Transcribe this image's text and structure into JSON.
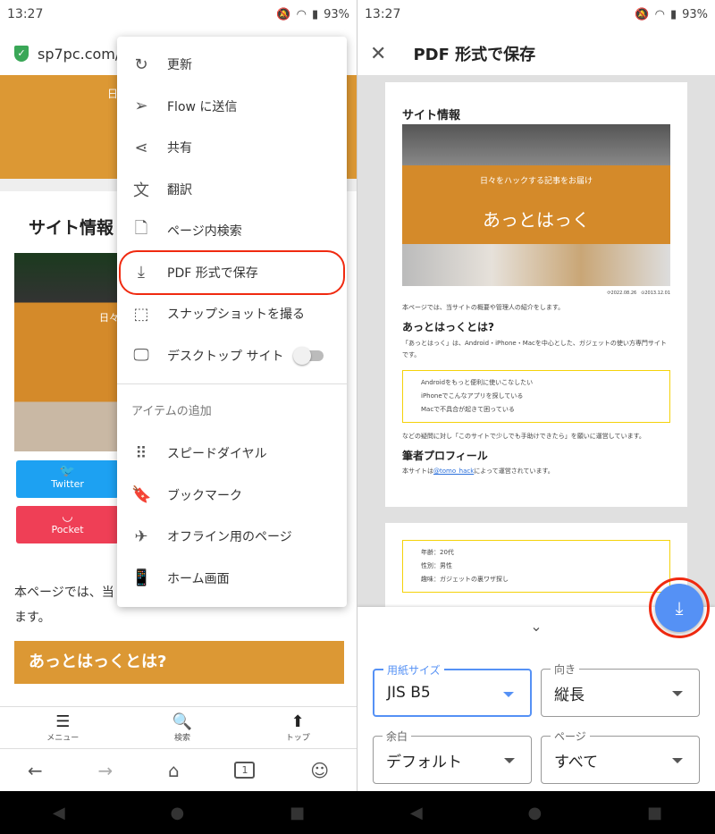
{
  "left": {
    "status": {
      "time": "13:27",
      "battery": "93%"
    },
    "url": "sp7pc.com/",
    "page": {
      "heading": "サイト情報",
      "tagline": "日々",
      "share": [
        {
          "label": "Twitter",
          "color": "#1da1f2"
        },
        {
          "label": "Pocket",
          "color": "#ef3f56"
        }
      ],
      "intro": "本ページでは、当",
      "intro2": "ます。",
      "section": "あっとはっくとは?"
    },
    "menu": {
      "items": [
        {
          "icon": "refresh-icon",
          "label": "更新"
        },
        {
          "icon": "send-icon",
          "label": "Flow に送信"
        },
        {
          "icon": "share-icon",
          "label": "共有"
        },
        {
          "icon": "translate-icon",
          "label": "翻訳"
        },
        {
          "icon": "find-in-page-icon",
          "label": "ページ内検索"
        },
        {
          "icon": "download-icon",
          "label": "PDF 形式で保存"
        },
        {
          "icon": "snapshot-icon",
          "label": "スナップショットを撮る"
        },
        {
          "icon": "desktop-icon",
          "label": "デスクトップ サイト",
          "toggle": false
        }
      ],
      "section": "アイテムの追加",
      "add_items": [
        {
          "icon": "speed-dial-icon",
          "label": "スピードダイヤル"
        },
        {
          "icon": "bookmark-icon",
          "label": "ブックマーク"
        },
        {
          "icon": "airplane-icon",
          "label": "オフライン用のページ"
        },
        {
          "icon": "home-screen-icon",
          "label": "ホーム画面"
        }
      ]
    },
    "bottom_nav": [
      {
        "icon": "menu-icon",
        "label": "メニュー"
      },
      {
        "icon": "search-icon",
        "label": "検索"
      },
      {
        "icon": "arrow-up-icon",
        "label": "トップ"
      }
    ],
    "tab_count": "1"
  },
  "right": {
    "status": {
      "time": "13:27",
      "battery": "93%"
    },
    "title": "PDF 形式で保存",
    "preview": {
      "heading": "サイト情報",
      "tagline": "日々をハックする記事をお届け",
      "site": "あっとはっく",
      "dates": "⟳2022.08.26　⊙2013.12.01",
      "intro": "本ページでは、当サイトの概要や管理人の紹介をします。",
      "h2": "あっとはっくとは?",
      "p": "「あっとはっく」は、Android・iPhone・Macを中心とした、ガジェットの使い方専門サイトです。",
      "bullets": [
        "Androidをもっと便利に使いこなしたい",
        "iPhoneでこんなアプリを探している",
        "Macで不具合が起きて困っている"
      ],
      "p2": "などの疑問に対し「このサイトで少しでも手助けできたら」を願いに運営しています。",
      "h3": "筆者プロフィール",
      "p3a": "本サイトは",
      "link": "@tomo_hack",
      "p3b": "によって運営されています。",
      "bullets2": [
        "年齢：20代",
        "性別：男性",
        "趣味：ガジェットの裏ワザ探し"
      ]
    },
    "fields": [
      {
        "label": "用紙サイズ",
        "value": "JIS B5"
      },
      {
        "label": "向き",
        "value": "縦長"
      },
      {
        "label": "余白",
        "value": "デフォルト"
      },
      {
        "label": "ページ",
        "value": "すべて"
      }
    ],
    "accent": "#5591f5",
    "highlight": "#f02a10"
  }
}
